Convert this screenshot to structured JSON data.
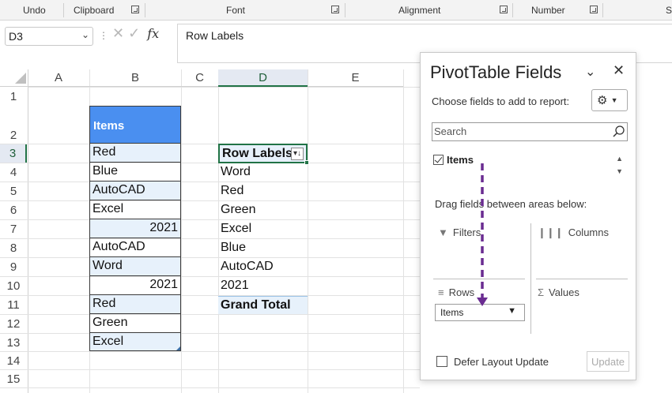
{
  "ribbon": {
    "groups": [
      "Undo",
      "Clipboard",
      "Font",
      "Alignment",
      "Number",
      "S"
    ]
  },
  "formula_bar": {
    "name_box": "D3",
    "formula": "Row Labels"
  },
  "grid": {
    "columns": [
      "A",
      "B",
      "C",
      "D",
      "E"
    ],
    "rows": [
      "1",
      "2",
      "3",
      "4",
      "5",
      "6",
      "7",
      "8",
      "9",
      "10",
      "11",
      "12",
      "13",
      "14",
      "15"
    ],
    "selected_column": "D",
    "selected_row": "3",
    "table": {
      "header": "Items",
      "items": [
        "Red",
        "Blue",
        "AutoCAD",
        "Excel",
        "2021",
        "AutoCAD",
        "Word",
        "2021",
        "Red",
        "Green",
        "Excel"
      ]
    },
    "pivot": {
      "header": "Row Labels",
      "items": [
        "Word",
        "Red",
        "Green",
        "Excel",
        "Blue",
        "AutoCAD",
        "2021"
      ],
      "total": "Grand Total"
    }
  },
  "pivot_pane": {
    "title": "PivotTable Fields",
    "subtitle": "Choose fields to add to report:",
    "search_placeholder": "Search",
    "field": "Items",
    "drag_text": "Drag fields between areas below:",
    "filters": "Filters",
    "columns": "Columns",
    "rows": "Rows",
    "values": "Values",
    "rows_item": "Items",
    "defer": "Defer Layout Update",
    "update": "Update"
  },
  "colors": {
    "header_fill": "#4a8ff0",
    "band_fill": "#e7f1fb",
    "arrow": "#6a2c91",
    "selection": "#217346"
  }
}
